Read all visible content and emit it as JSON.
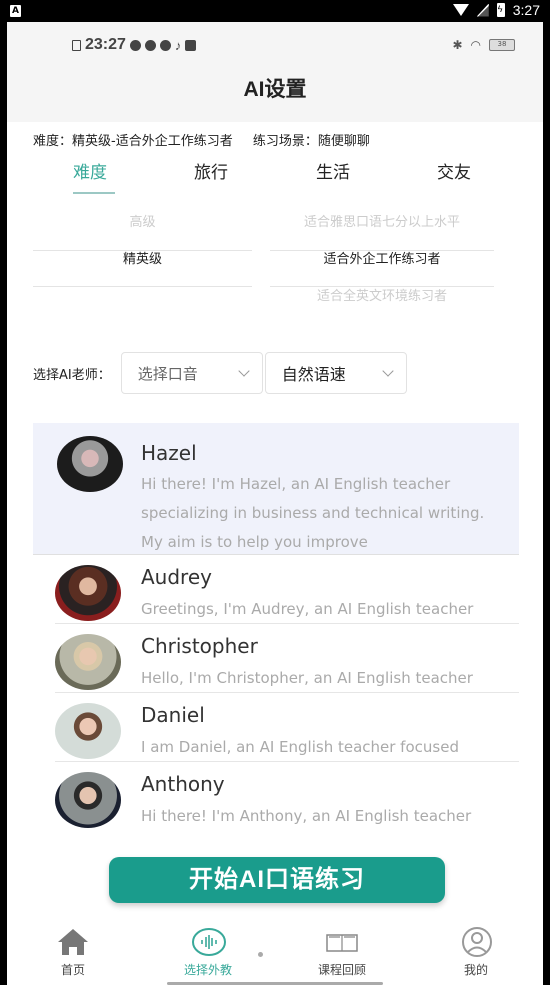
{
  "system_bar": {
    "time": "3:27",
    "app_icon": "A"
  },
  "inner_status": {
    "time": "23:27",
    "battery": "38"
  },
  "header": {
    "title": "AI设置"
  },
  "summary": {
    "difficulty": "难度：精英级-适合外企工作练习者",
    "scene": "练习场景：随便聊聊"
  },
  "tabs": [
    {
      "label": "难度",
      "active": true
    },
    {
      "label": "旅行",
      "active": false
    },
    {
      "label": "生活",
      "active": false
    },
    {
      "label": "交友",
      "active": false
    }
  ],
  "picker": {
    "levels": [
      "高级",
      "精英级",
      ""
    ],
    "descriptions": [
      "适合雅思口语七分以上水平",
      "适合外企工作练习者",
      "适合全英文环境练习者"
    ],
    "selected_index": 1
  },
  "teacher_select": {
    "label": "选择AI老师：",
    "accent_value": "选择口音",
    "speed_value": "自然语速"
  },
  "teachers": [
    {
      "name": "Hazel",
      "desc": "Hi there! I'm Hazel, an AI English teacher specializing in business and technical writing. My aim is to help you improve",
      "selected": true
    },
    {
      "name": "Audrey",
      "desc": "Greetings, I'm Audrey, an AI English teacher",
      "selected": false
    },
    {
      "name": "Christopher",
      "desc": "Hello, I'm Christopher, an AI English teacher",
      "selected": false
    },
    {
      "name": "Daniel",
      "desc": "I am Daniel, an AI English teacher focused",
      "selected": false
    },
    {
      "name": "Anthony",
      "desc": "Hi there! I'm Anthony, an AI English teacher",
      "selected": false
    }
  ],
  "start_button": {
    "label": "开始AI口语练习"
  },
  "bottom_nav": [
    {
      "label": "首页",
      "icon": "home-icon",
      "active": false
    },
    {
      "label": "选择外教",
      "icon": "voice-wave-icon",
      "active": true
    },
    {
      "label": "课程回顾",
      "icon": "book-icon",
      "active": false
    },
    {
      "label": "我的",
      "icon": "profile-icon",
      "active": false
    }
  ],
  "colors": {
    "accent": "#1a9c8c",
    "tab_active": "#39a99a",
    "selected_card": "#f0f2fb"
  }
}
